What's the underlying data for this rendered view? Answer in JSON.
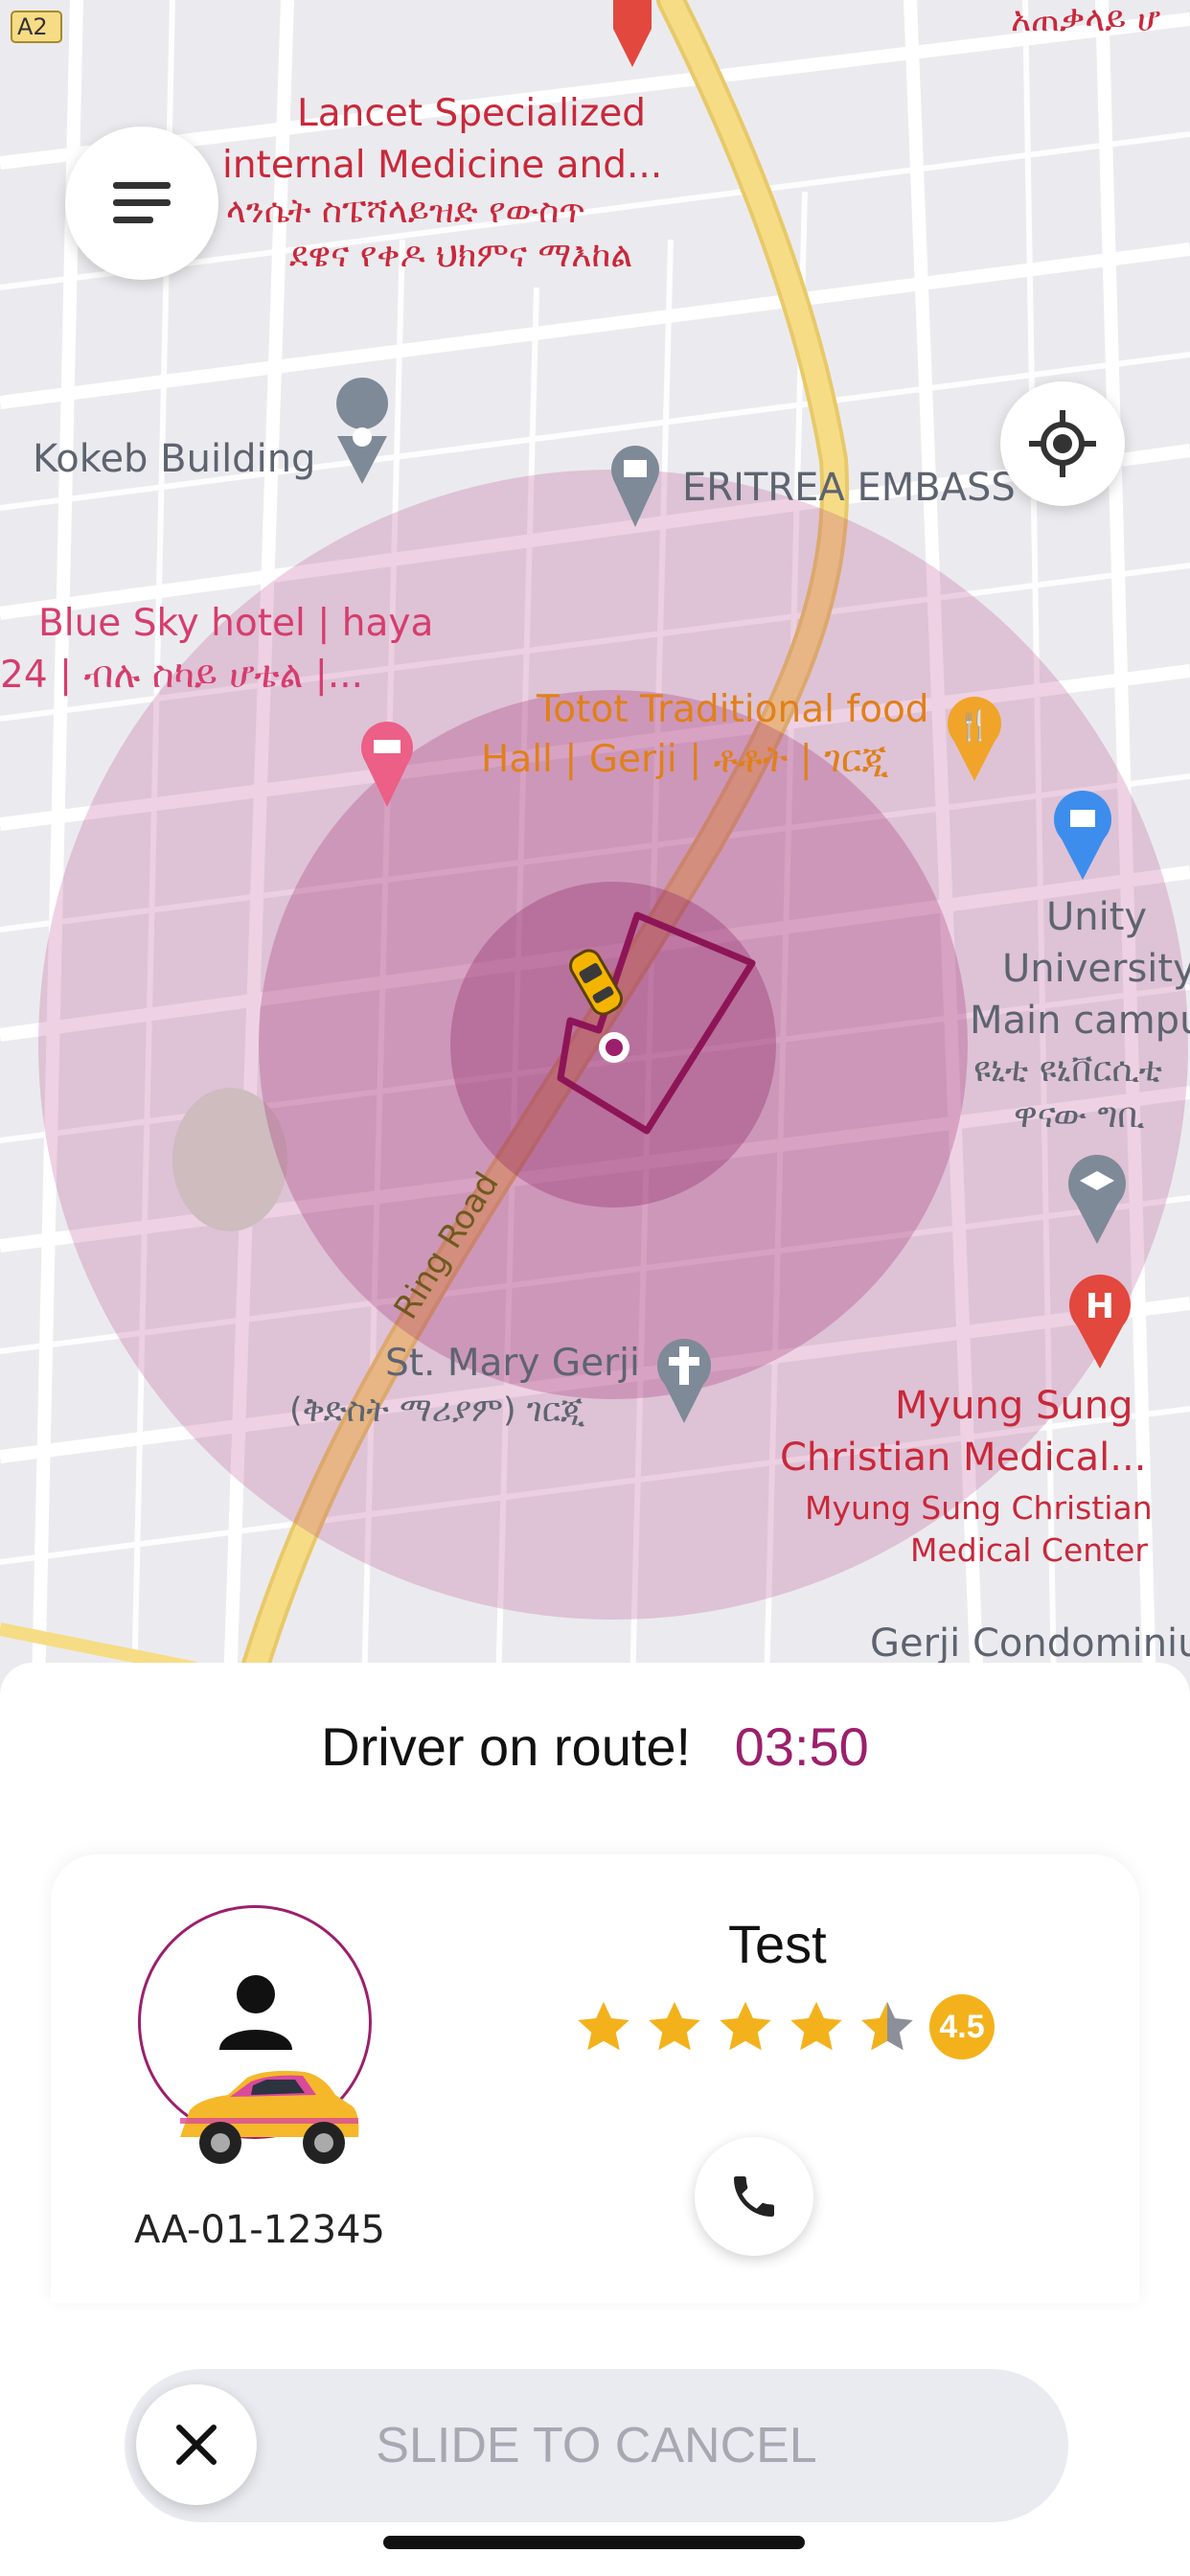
{
  "map": {
    "road_badge": "A2",
    "labels": {
      "lancet_en": "Lancet Specialized",
      "lancet_en2": "internal Medicine and...",
      "lancet_am": "ላንሴት ስፔሻላይዝድ የውስጥ",
      "lancet_am2": "ደዌና የቀዶ ህክምና ማእከል",
      "top_right_am": "አጠቃላይ ሆ",
      "kokeb": "Kokeb Building",
      "eritrea": "ERITREA EMBASS",
      "bluesky": "Blue Sky hotel | haya",
      "bluesky2": "24 | ብሉ ስካይ ሆቴል |...",
      "totot": "Totot Traditional food",
      "totot2": "Hall | Gerji | ቶቶት | ገርጂ",
      "unity": "Unity",
      "unity2": "University",
      "unity3": "Main campu",
      "unity_am": "ዩኒቲ ዩኒቨርሲቲ",
      "unity_am2": "ዋናው ግቢ",
      "ring_road": "Ring Road",
      "stmary": "St. Mary Gerji",
      "stmary_am": "(ቅድስት ማሪያም) ገርጂ",
      "myung": "Myung Sung",
      "myung2": "Christian Medical...",
      "myung3": "Myung Sung Christian",
      "myung4": "Medical Center",
      "gerji": "Gerji Condominiu"
    }
  },
  "sheet": {
    "status_text": "Driver on route!",
    "eta": "03:50"
  },
  "driver": {
    "name": "Test",
    "rating": "4.5",
    "rating_value": 4.5,
    "plate": "AA-01-12345"
  },
  "slider": {
    "label": "SLIDE TO CANCEL"
  },
  "colors": {
    "accent": "#9c1f6c",
    "star": "#f3b21c",
    "zone": "#b0307e"
  },
  "icons": {
    "menu": "menu-icon",
    "locate": "crosshair-icon",
    "call": "phone-icon",
    "cancel": "close-icon"
  }
}
